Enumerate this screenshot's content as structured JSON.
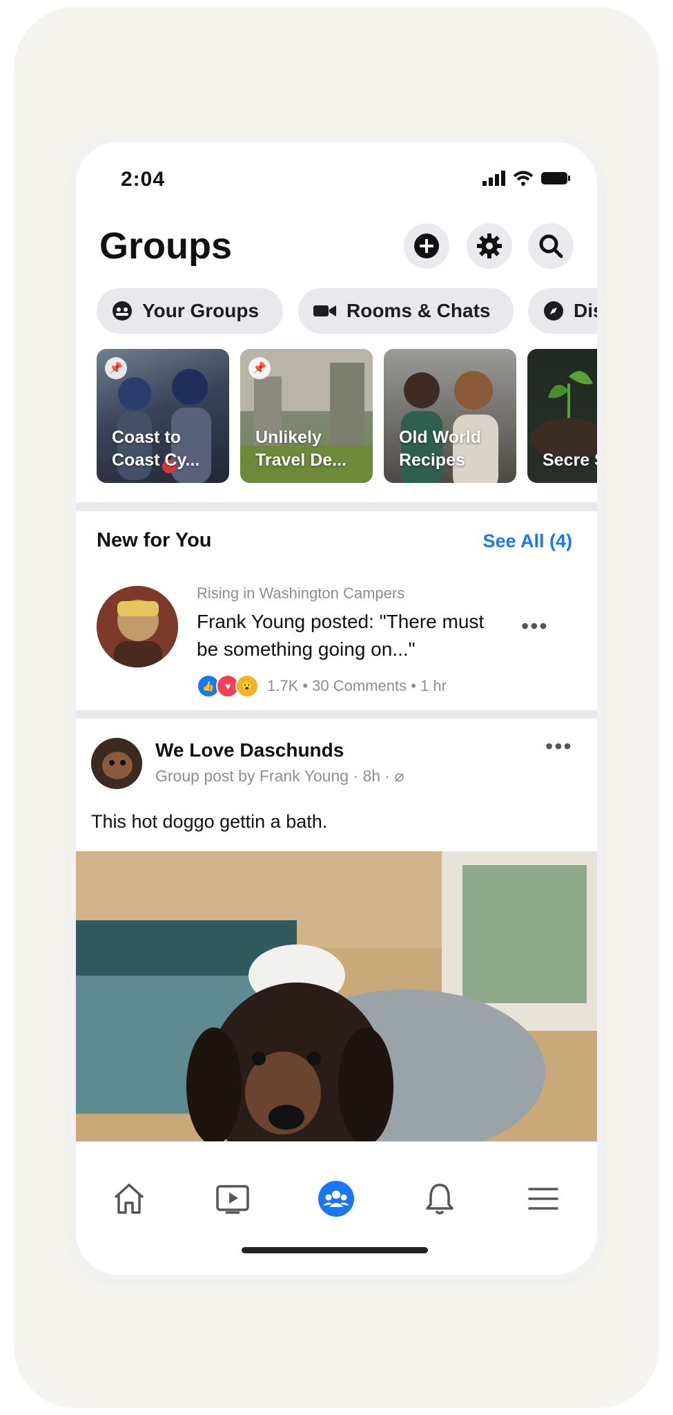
{
  "status_bar": {
    "time": "2:04"
  },
  "header": {
    "title": "Groups"
  },
  "icons": {
    "create": "plus-circle-icon",
    "settings": "gear-icon",
    "search": "search-icon"
  },
  "chips": [
    {
      "label": "Your Groups",
      "icon": "groups-icon"
    },
    {
      "label": "Rooms & Chats",
      "icon": "video-camera-icon"
    },
    {
      "label": "Dis",
      "icon": "compass-icon"
    }
  ],
  "pinned_groups": [
    {
      "label": "Coast to Coast Cy..."
    },
    {
      "label": "Unlikely Travel De..."
    },
    {
      "label": "Old World Recipes"
    },
    {
      "label": "Secre Sneer"
    }
  ],
  "new_for_you": {
    "title": "New for You",
    "see_all": "See All (4)",
    "item": {
      "context": "Rising in Washington Campers",
      "text": "Frank Young posted: \"There must be something going on...\"",
      "stats": "1.7K • 30 Comments • 1 hr"
    }
  },
  "post": {
    "group_name": "We Love Daschunds",
    "meta": "Group post by Frank Young · 8h · ⌀",
    "caption": "This hot doggo gettin a bath."
  },
  "bottom_nav": {
    "active": "groups",
    "items": [
      "home",
      "watch",
      "groups",
      "notifications",
      "menu"
    ]
  },
  "colors": {
    "accent": "#1877f2",
    "background": "#f5f3ee",
    "chip_bg": "#e9e9ed"
  }
}
